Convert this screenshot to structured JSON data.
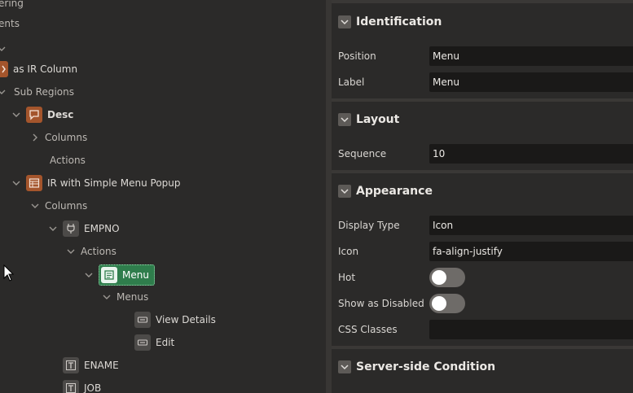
{
  "tree": {
    "items": [
      {
        "label": "ering"
      },
      {
        "label": "ents"
      },
      {
        "label": "as IR Column"
      },
      {
        "label": "Sub Regions"
      },
      {
        "label": "Desc"
      },
      {
        "label": "Columns"
      },
      {
        "label": "Actions"
      },
      {
        "label": "IR with Simple Menu Popup"
      },
      {
        "label": "Columns"
      },
      {
        "label": "EMPNO"
      },
      {
        "label": "Actions"
      },
      {
        "label": "Menu"
      },
      {
        "label": "Menus"
      },
      {
        "label": "View Details"
      },
      {
        "label": "Edit"
      },
      {
        "label": "ENAME"
      },
      {
        "label": "JOB"
      }
    ]
  },
  "properties": {
    "identification": {
      "title": "Identification",
      "position_label": "Position",
      "position_value": "Menu",
      "label_label": "Label",
      "label_value": "Menu"
    },
    "layout": {
      "title": "Layout",
      "sequence_label": "Sequence",
      "sequence_value": "10"
    },
    "appearance": {
      "title": "Appearance",
      "display_type_label": "Display Type",
      "display_type_value": "Icon",
      "icon_label": "Icon",
      "icon_value": "fa-align-justify",
      "hot_label": "Hot",
      "hot_on": false,
      "show_disabled_label": "Show as Disabled",
      "show_disabled_on": false,
      "css_classes_label": "CSS Classes",
      "css_classes_value": ""
    },
    "server_side": {
      "title": "Server-side Condition"
    }
  },
  "colors": {
    "background": "#2b2a29",
    "input_bg": "#1a1918",
    "selected_green": "#2f7d4c",
    "region_orange": "#a4552c"
  }
}
